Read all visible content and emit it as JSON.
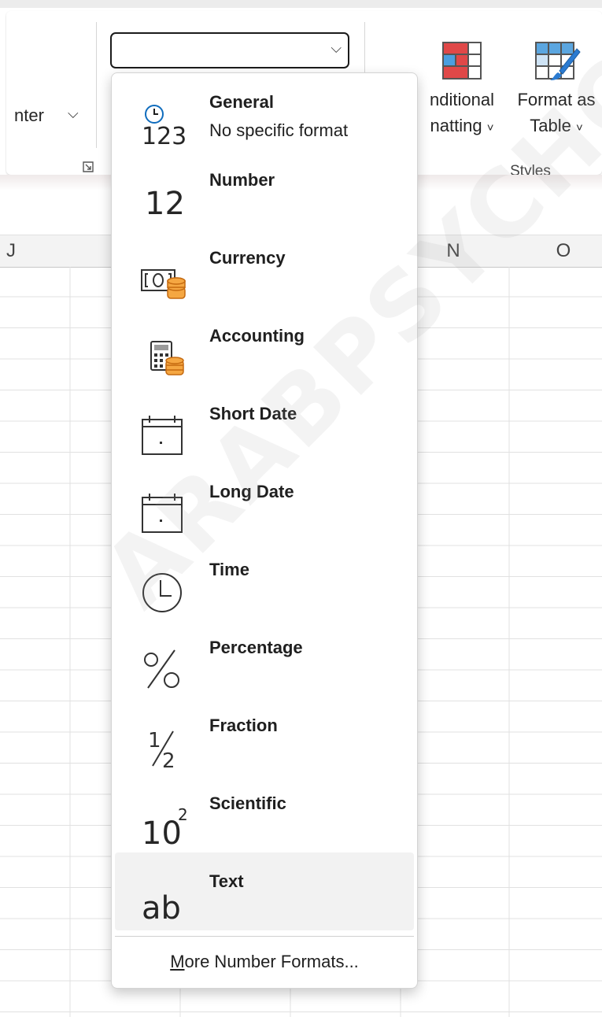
{
  "ribbon": {
    "merge_label": "nter",
    "conditional_formatting": {
      "line1": "nditional",
      "line2": "natting"
    },
    "format_as_table": {
      "line1": "Format as",
      "line2": "Table"
    },
    "styles_group_label": "Styles",
    "number_format_combo_value": ""
  },
  "columns": [
    "J",
    "N",
    "O"
  ],
  "number_format_menu": {
    "items": [
      {
        "title": "General",
        "subtitle": "No specific format",
        "icon": "clock-123-icon"
      },
      {
        "title": "Number",
        "icon": "number-12-icon",
        "glyph": "12"
      },
      {
        "title": "Currency",
        "icon": "currency-icon"
      },
      {
        "title": "Accounting",
        "icon": "calculator-coins-icon"
      },
      {
        "title": "Short Date",
        "icon": "calendar-icon"
      },
      {
        "title": "Long Date",
        "icon": "calendar-icon"
      },
      {
        "title": "Time",
        "icon": "clock-icon"
      },
      {
        "title": "Percentage",
        "icon": "percent-icon",
        "glyph": "%"
      },
      {
        "title": "Fraction",
        "icon": "fraction-icon"
      },
      {
        "title": "Scientific",
        "icon": "scientific-icon"
      },
      {
        "title": "Text",
        "icon": "text-ab-icon",
        "glyph": "ab"
      }
    ],
    "highlighted_item": "Text",
    "more_formats": {
      "accelerator": "M",
      "rest": "ore Number Formats..."
    }
  },
  "watermark": "ARABPSYCHOL",
  "colors": {
    "accent_blue": "#0f6cbd",
    "coin_orange": "#e8831a",
    "cf_red": "#e04848"
  }
}
